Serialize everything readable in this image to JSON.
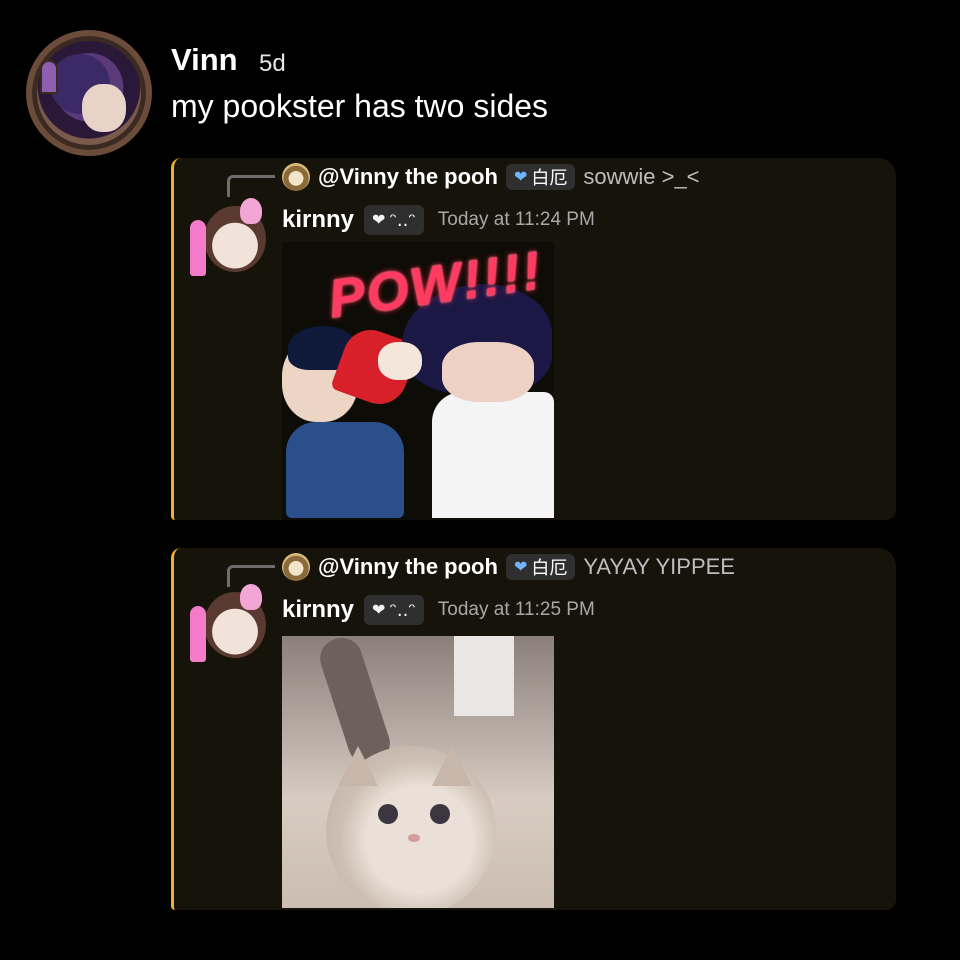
{
  "post": {
    "author": "Vinn",
    "time": "5d",
    "text": "my pookster has two sides"
  },
  "embeds": [
    {
      "reply": {
        "name": "@Vinny the pooh",
        "tag": "白厄",
        "content": "sowwie >_<"
      },
      "user": {
        "name": "kirnny",
        "tag": "ᵔ..ᵔ",
        "time": "Today at 11:24 PM"
      },
      "media": {
        "type": "sticker",
        "text": "POW!!!!"
      }
    },
    {
      "reply": {
        "name": "@Vinny the pooh",
        "tag": "白厄",
        "content": "YAYAY YIPPEE"
      },
      "user": {
        "name": "kirnny",
        "tag": "ᵔ..ᵔ",
        "time": "Today at 11:25 PM"
      },
      "media": {
        "type": "gif"
      }
    }
  ],
  "icons": {
    "reply_tag_icon": "heart-icon",
    "user_tag_icon": "heart-icon"
  },
  "colors": {
    "embed_accent": "#f0b232",
    "embed_bg": "#16130a",
    "page_bg": "#000000"
  }
}
